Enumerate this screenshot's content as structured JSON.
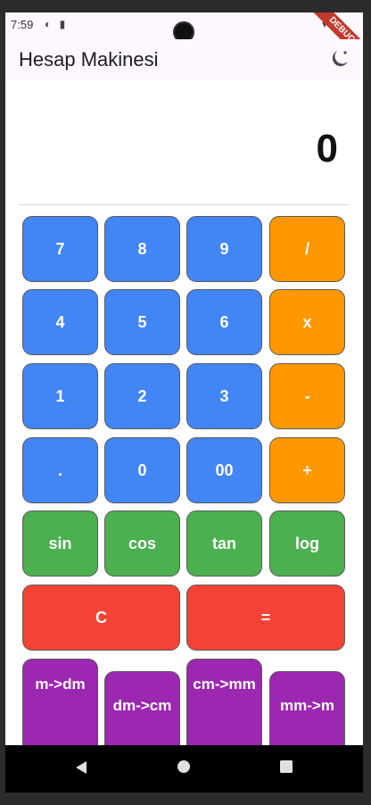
{
  "status_bar": {
    "time": "7:59",
    "left_icons": "◐ ▮",
    "right_icons": "▾ ▮"
  },
  "debug_banner": "DEBUG",
  "app_bar": {
    "title": "Hesap Makinesi",
    "theme_icon": "dark-mode-icon"
  },
  "display": {
    "value": "0"
  },
  "keypad": {
    "rows": [
      [
        "7",
        "8",
        "9",
        "/"
      ],
      [
        "4",
        "5",
        "6",
        "x"
      ],
      [
        "1",
        "2",
        "3",
        "-"
      ],
      [
        ".",
        "0",
        "00",
        "+"
      ],
      [
        "sin",
        "cos",
        "tan",
        "log"
      ]
    ],
    "clear": "C",
    "equals": "=",
    "converters": [
      "m->dm",
      "dm->cm",
      "cm->mm",
      "mm->m"
    ]
  },
  "nav_bar": {
    "back_icon": "back-triangle-icon",
    "home_icon": "home-circle-icon",
    "recent_icon": "recent-square-icon"
  },
  "colors": {
    "number_key": "#4285f4",
    "operator_key": "#ff9800",
    "function_key": "#4caf50",
    "control_key": "#f44336",
    "converter_key": "#9c27b0"
  }
}
